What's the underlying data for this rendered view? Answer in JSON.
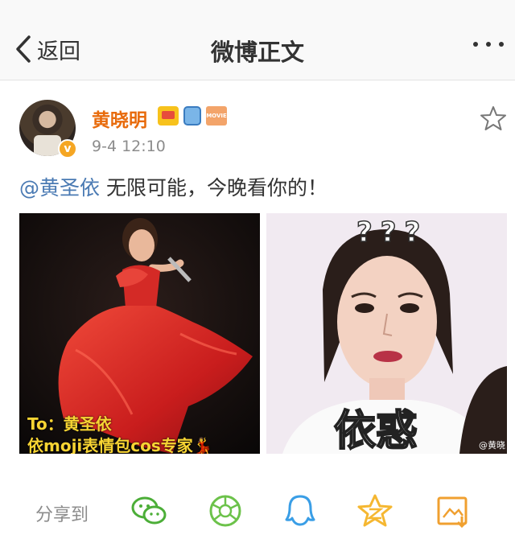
{
  "navbar": {
    "back_label": "返回",
    "title": "微博正文"
  },
  "post": {
    "username": "黄晓明",
    "time": "9-4 12:10",
    "mention": "@黄圣依",
    "text": " 无限可能，今晚看你的！",
    "badges": [
      "crown-icon",
      "bag-icon",
      "movie-icon"
    ],
    "badge_movie_text": "MOVIE",
    "vip_mark": "v"
  },
  "images": [
    {
      "caption_line1": "To：黄圣依",
      "caption_line2": "依moji表情包cos专家",
      "caption_symbol": "💃"
    },
    {
      "question_marks": "???",
      "meme_text": "依惑",
      "watermark": "@黄晓"
    }
  ],
  "share": {
    "label": "分享到",
    "icons": [
      "wechat-icon",
      "moments-icon",
      "qq-icon",
      "qzone-icon",
      "save-icon"
    ]
  },
  "colors": {
    "username": "#e86b0c",
    "mention": "#4a7ab3",
    "wechat": "#4cae38",
    "moments": "#6cc24a",
    "qq": "#3a9ee6",
    "qzone": "#f5b731",
    "save": "#f0a030"
  }
}
